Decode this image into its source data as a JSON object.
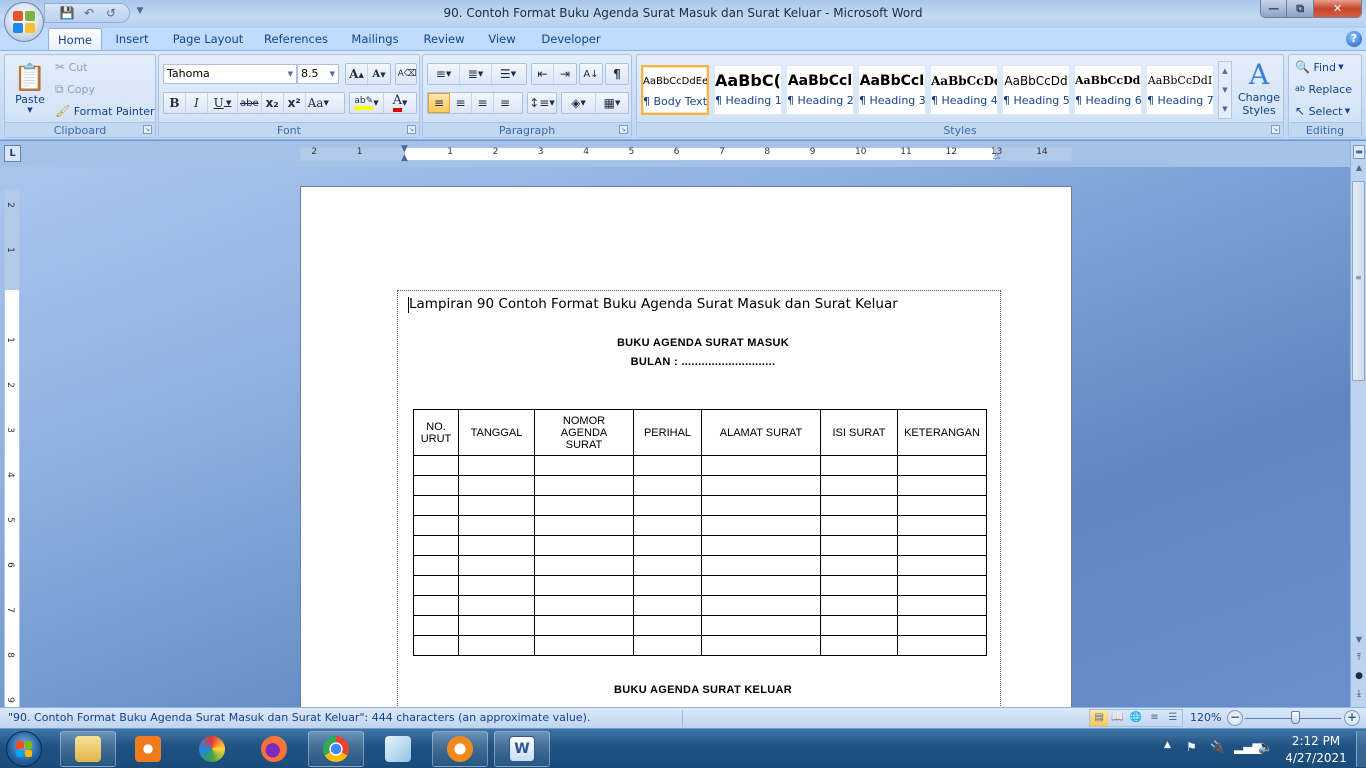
{
  "window": {
    "title": "90. Contoh Format Buku Agenda Surat Masuk dan Surat Keluar - Microsoft Word",
    "controls": {
      "minimize": "minimize",
      "restore": "restore",
      "close": "close"
    }
  },
  "quick_access": {
    "save_icon": "save-icon",
    "undo_icon": "undo-icon",
    "redo_icon": "redo-icon"
  },
  "tabs": [
    {
      "label": "Home",
      "active": true
    },
    {
      "label": "Insert"
    },
    {
      "label": "Page Layout"
    },
    {
      "label": "References"
    },
    {
      "label": "Mailings"
    },
    {
      "label": "Review"
    },
    {
      "label": "View"
    },
    {
      "label": "Developer"
    }
  ],
  "ribbon": {
    "clipboard": {
      "label": "Clipboard",
      "paste": "Paste",
      "cut": "Cut",
      "copy": "Copy",
      "format_painter": "Format Painter"
    },
    "font": {
      "label": "Font",
      "font_name": "Tahoma",
      "font_size": "8.5",
      "bold": "B",
      "italic": "I",
      "underline": "U",
      "strikethrough": "abe",
      "subscript": "x₂",
      "superscript": "x²",
      "change_case": "Aa",
      "grow": "A",
      "shrink": "A",
      "highlight_color": "#ffff00",
      "font_color": "#e00000"
    },
    "paragraph": {
      "label": "Paragraph",
      "pilcrow": "¶"
    },
    "styles": {
      "label": "Styles",
      "items": [
        {
          "sample": "AaBbCcDdEe",
          "name": "¶ Body Text",
          "selected": true
        },
        {
          "sample": "AaBbC(",
          "name": "¶ Heading 1"
        },
        {
          "sample": "AaBbCcl",
          "name": "¶ Heading 2"
        },
        {
          "sample": "AaBbCcI",
          "name": "¶ Heading 3"
        },
        {
          "sample": "AaBbCcDd",
          "name": "¶ Heading 4"
        },
        {
          "sample": "AaBbCcDd",
          "name": "¶ Heading 5"
        },
        {
          "sample": "AaBbCcDdl",
          "name": "¶ Heading 6"
        },
        {
          "sample": "AaBbCcDdI",
          "name": "¶ Heading 7"
        }
      ],
      "change_styles": "Change Styles"
    },
    "editing": {
      "label": "Editing",
      "find": "Find",
      "replace": "Replace",
      "select": "Select"
    }
  },
  "ruler": {
    "left_numbers": [
      "2",
      "1"
    ],
    "right_numbers": [
      "1",
      "2",
      "3",
      "4",
      "5",
      "6",
      "7",
      "8",
      "9",
      "10",
      "11",
      "12",
      "13",
      "14"
    ],
    "vertical_numbers": [
      "2",
      "1",
      "1",
      "2",
      "3",
      "4",
      "5",
      "6",
      "7",
      "8",
      "9"
    ]
  },
  "document": {
    "line1": "Lampiran 90 Contoh Format Buku Agenda Surat Masuk dan Surat Keluar",
    "heading_masuk": "BUKU AGENDA SURAT MASUK",
    "bulan": "BULAN  : ............................",
    "table_headers": [
      "NO. URUT",
      "TANGGAL",
      "NOMOR AGENDA SURAT",
      "PERIHAL",
      "ALAMAT SURAT",
      "ISI SURAT",
      "KETERANGAN"
    ],
    "empty_rows": 10,
    "heading_keluar": "BUKU AGENDA SURAT KELUAR"
  },
  "status": {
    "text": "\"90. Contoh Format Buku Agenda Surat Masuk dan Surat Keluar\": 444 characters (an approximate value).",
    "zoom": "120%",
    "zoom_percent": 120
  },
  "taskbar": {
    "apps": [
      "Windows Explorer",
      "Windows Media Player",
      "Paint",
      "Firefox",
      "Chrome",
      "Notepad",
      "GOM Player",
      "Microsoft Word"
    ],
    "time": "2:12 PM",
    "date": "4/27/2021"
  }
}
